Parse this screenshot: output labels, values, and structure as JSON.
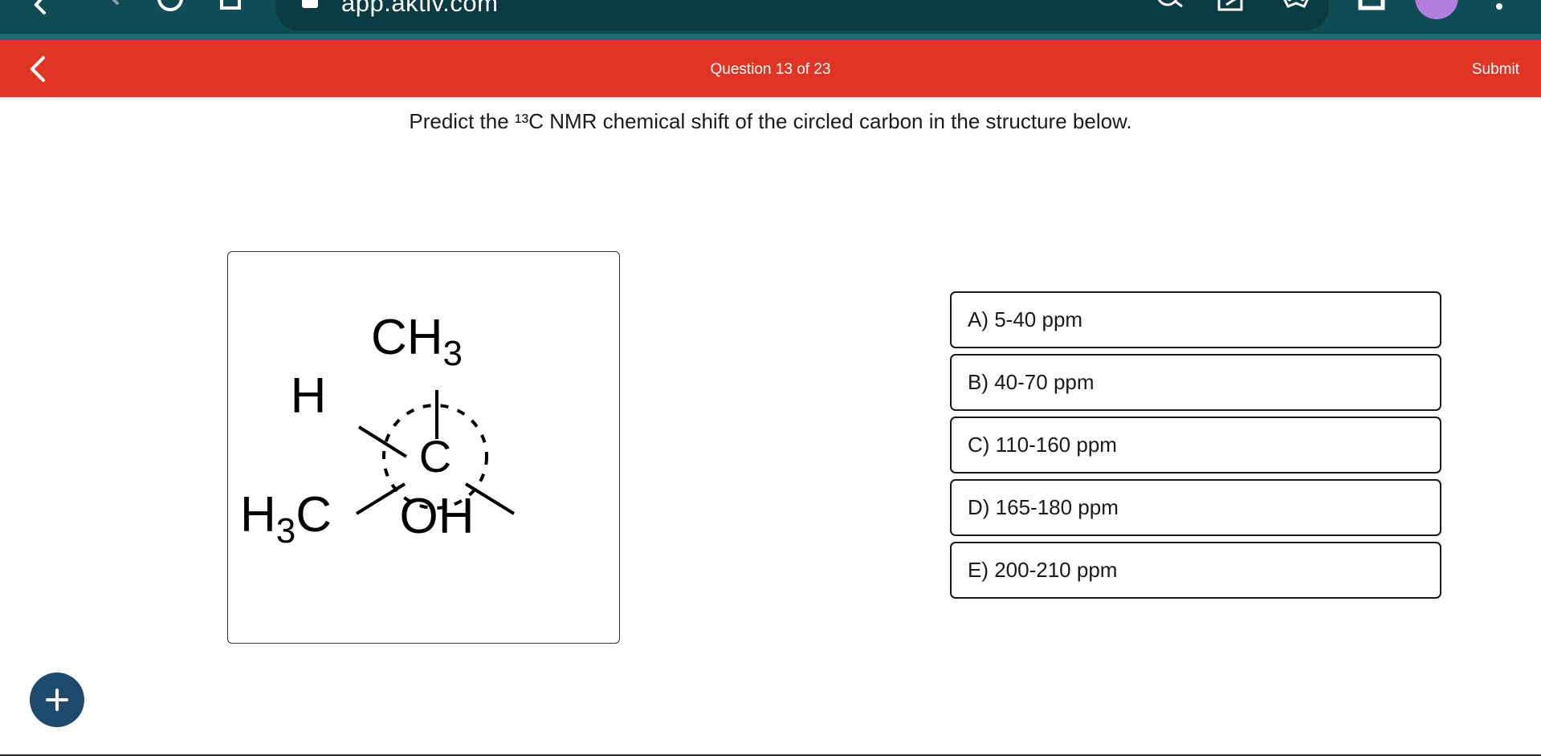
{
  "browser": {
    "url": "app.aktiv.com"
  },
  "header": {
    "title": "Question 13 of 23",
    "submit_label": "Submit"
  },
  "question": {
    "prompt": "Predict the ¹³C NMR chemical shift of the circled carbon in the structure below."
  },
  "structure": {
    "top_group": "CH",
    "top_sub": "3",
    "left_upper": "H",
    "left_lower_prefix": "H",
    "left_lower_sub": "3",
    "left_lower_suffix": "C",
    "center": "C",
    "right": "OH"
  },
  "choices": [
    {
      "label": "A) 5-40 ppm"
    },
    {
      "label": "B) 40-70 ppm"
    },
    {
      "label": "C) 110-160 ppm"
    },
    {
      "label": "D) 165-180 ppm"
    },
    {
      "label": "E) 200-210 ppm"
    }
  ],
  "colors": {
    "header_red": "#e03524",
    "chrome_teal": "#0f4c56",
    "fab_navy": "#1e4a6e"
  },
  "icons": {
    "back": "chevron-left-icon",
    "fab": "plus-icon"
  }
}
